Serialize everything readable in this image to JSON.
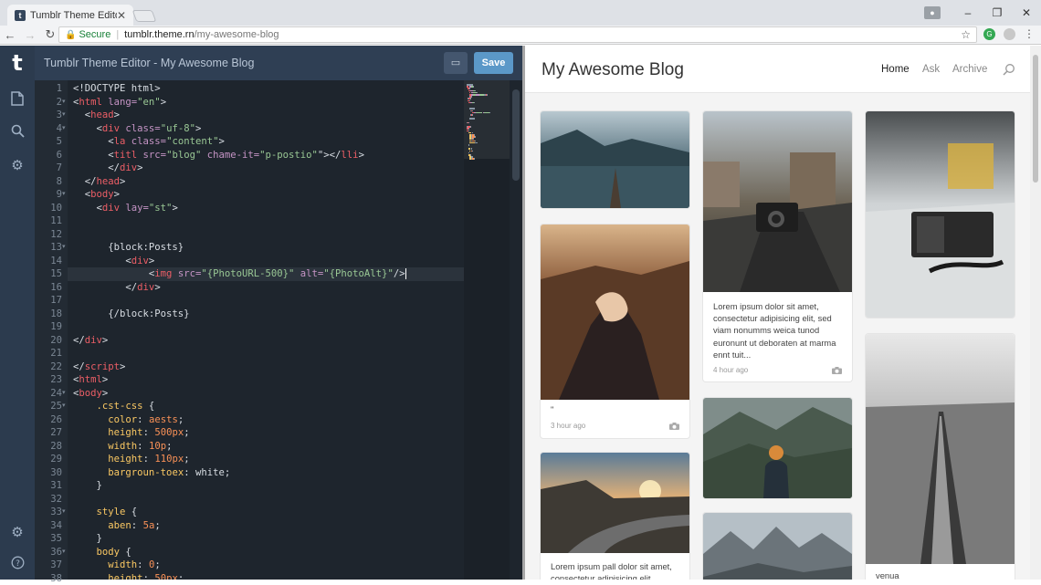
{
  "browser": {
    "tab_title": "Tumblr Theme Editor",
    "tab_close": "✕",
    "secure_label": "Secure",
    "url_host": "tumblr.theme.rn",
    "url_path": "/my-awesome-blog",
    "window_min": "–",
    "window_max": "❐",
    "window_close": "✕"
  },
  "editor": {
    "logo": "t",
    "title": "Tumblr Theme Editor - My Awesome Blog",
    "save_label": "Save",
    "lines": [
      [
        [
          "t-txt",
          "<!DOCTYPE html>"
        ]
      ],
      [
        [
          "t-txt",
          "<"
        ],
        [
          "t-tag",
          "html "
        ],
        [
          "t-attr",
          "lang="
        ],
        [
          "t-str",
          "\"en\""
        ],
        [
          "t-txt",
          ">"
        ]
      ],
      [
        [
          "t-txt",
          "  <"
        ],
        [
          "t-tag",
          "head"
        ],
        [
          "t-txt",
          ">"
        ]
      ],
      [
        [
          "t-txt",
          "    <"
        ],
        [
          "t-tag",
          "div "
        ],
        [
          "t-attr",
          "class="
        ],
        [
          "t-str",
          "\"uf-8\""
        ],
        [
          "t-txt",
          ">"
        ]
      ],
      [
        [
          "t-txt",
          "      <"
        ],
        [
          "t-tag",
          "la "
        ],
        [
          "t-attr",
          "class="
        ],
        [
          "t-str",
          "\"content\""
        ],
        [
          "t-txt",
          ">"
        ]
      ],
      [
        [
          "t-txt",
          "      <"
        ],
        [
          "t-tag",
          "titl "
        ],
        [
          "t-attr",
          "src="
        ],
        [
          "t-str",
          "\"blog\" "
        ],
        [
          "t-attr",
          "chame-it="
        ],
        [
          "t-str",
          "\"p-postio\""
        ],
        [
          "t-txt",
          "\"></"
        ],
        [
          "t-tag",
          "lli"
        ],
        [
          "t-txt",
          ">"
        ]
      ],
      [
        [
          "t-txt",
          "      </"
        ],
        [
          "t-tag",
          "div"
        ],
        [
          "t-txt",
          ">"
        ]
      ],
      [
        [
          "t-txt",
          "  </"
        ],
        [
          "t-tag",
          "head"
        ],
        [
          "t-txt",
          ">"
        ]
      ],
      [
        [
          "t-txt",
          "  <"
        ],
        [
          "t-tag",
          "body"
        ],
        [
          "t-txt",
          ">"
        ]
      ],
      [
        [
          "t-txt",
          "    <"
        ],
        [
          "t-tag",
          "div "
        ],
        [
          "t-attr",
          "lay="
        ],
        [
          "t-str",
          "\"st\""
        ],
        [
          "t-txt",
          ">"
        ]
      ],
      [],
      [],
      [
        [
          "t-txt",
          "      {block:Posts}"
        ]
      ],
      [
        [
          "t-txt",
          "         <"
        ],
        [
          "t-tag",
          "div"
        ],
        [
          "t-txt",
          ">"
        ]
      ],
      [
        [
          "t-txt",
          "             <"
        ],
        [
          "t-tag",
          "img "
        ],
        [
          "t-attr",
          "src="
        ],
        [
          "t-str",
          "\"{PhotoURL-500}\" "
        ],
        [
          "t-attr",
          "alt="
        ],
        [
          "t-str",
          "\"{PhotoAlt}\""
        ],
        [
          "t-txt",
          "/>"
        ]
      ],
      [
        [
          "t-txt",
          "         </"
        ],
        [
          "t-tag",
          "div"
        ],
        [
          "t-txt",
          ">"
        ]
      ],
      [],
      [
        [
          "t-txt",
          "      {/block:Posts}"
        ]
      ],
      [],
      [
        [
          "t-txt",
          "</"
        ],
        [
          "t-tag",
          "div"
        ],
        [
          "t-txt",
          ">"
        ]
      ],
      [],
      [
        [
          "t-txt",
          "</"
        ],
        [
          "t-tag",
          "script"
        ],
        [
          "t-txt",
          ">"
        ]
      ],
      [
        [
          "t-txt",
          "<"
        ],
        [
          "t-tag",
          "html"
        ],
        [
          "t-txt",
          ">"
        ]
      ],
      [
        [
          "t-txt",
          "<"
        ],
        [
          "t-tag",
          "body"
        ],
        [
          "t-txt",
          ">"
        ]
      ],
      [
        [
          "t-txt",
          "    "
        ],
        [
          "t-prop",
          ".cst-css"
        ],
        [
          "t-txt",
          " {"
        ]
      ],
      [
        [
          "t-txt",
          "      "
        ],
        [
          "t-prop",
          "color"
        ],
        [
          "t-txt",
          ": "
        ],
        [
          "t-val",
          "aests"
        ],
        [
          "t-txt",
          ";"
        ]
      ],
      [
        [
          "t-txt",
          "      "
        ],
        [
          "t-prop",
          "height"
        ],
        [
          "t-txt",
          ": "
        ],
        [
          "t-val",
          "500px"
        ],
        [
          "t-txt",
          ";"
        ]
      ],
      [
        [
          "t-txt",
          "      "
        ],
        [
          "t-prop",
          "width"
        ],
        [
          "t-txt",
          ": "
        ],
        [
          "t-val",
          "10p"
        ],
        [
          "t-txt",
          ";"
        ]
      ],
      [
        [
          "t-txt",
          "      "
        ],
        [
          "t-prop",
          "height"
        ],
        [
          "t-txt",
          ": "
        ],
        [
          "t-val",
          "110px"
        ],
        [
          "t-txt",
          ";"
        ]
      ],
      [
        [
          "t-txt",
          "      "
        ],
        [
          "t-prop",
          "bargroun-toex"
        ],
        [
          "t-txt",
          ": white;"
        ]
      ],
      [
        [
          "t-txt",
          "    }"
        ]
      ],
      [],
      [
        [
          "t-txt",
          "    "
        ],
        [
          "t-prop",
          "style"
        ],
        [
          "t-txt",
          " {"
        ]
      ],
      [
        [
          "t-txt",
          "      "
        ],
        [
          "t-prop",
          "aben"
        ],
        [
          "t-txt",
          ": "
        ],
        [
          "t-val",
          "5a"
        ],
        [
          "t-txt",
          ";"
        ]
      ],
      [
        [
          "t-txt",
          "    }"
        ]
      ],
      [
        [
          "t-txt",
          "    "
        ],
        [
          "t-prop",
          "body"
        ],
        [
          "t-txt",
          " {"
        ]
      ],
      [
        [
          "t-txt",
          "      "
        ],
        [
          "t-prop",
          "width"
        ],
        [
          "t-txt",
          ": "
        ],
        [
          "t-val",
          "0"
        ],
        [
          "t-txt",
          ";"
        ]
      ],
      [
        [
          "t-txt",
          "      "
        ],
        [
          "t-prop",
          "height"
        ],
        [
          "t-txt",
          ": "
        ],
        [
          "t-val",
          "50px"
        ],
        [
          "t-txt",
          ";"
        ]
      ]
    ],
    "active_line": 15,
    "fold_lines": [
      2,
      3,
      4,
      9,
      13,
      24,
      25,
      33,
      36
    ]
  },
  "preview": {
    "blog_title": "My Awesome Blog",
    "nav": [
      "Home",
      "Ask",
      "Archive"
    ],
    "posts": {
      "p2_text": "Lorem ipsum dolor sit amet, consectetur adipisicing elit, sed viam nonumms weica tunod euronunt ut deboraten at marma ennt tuit...",
      "p2_time": "4 hour ago",
      "p4_caption": "\"",
      "p4_time": "3 hour ago",
      "p7_text": "Lorem ipsum pall dolor sit amet, consectetur adipisicing elit,",
      "p9_caption": "venua"
    }
  }
}
